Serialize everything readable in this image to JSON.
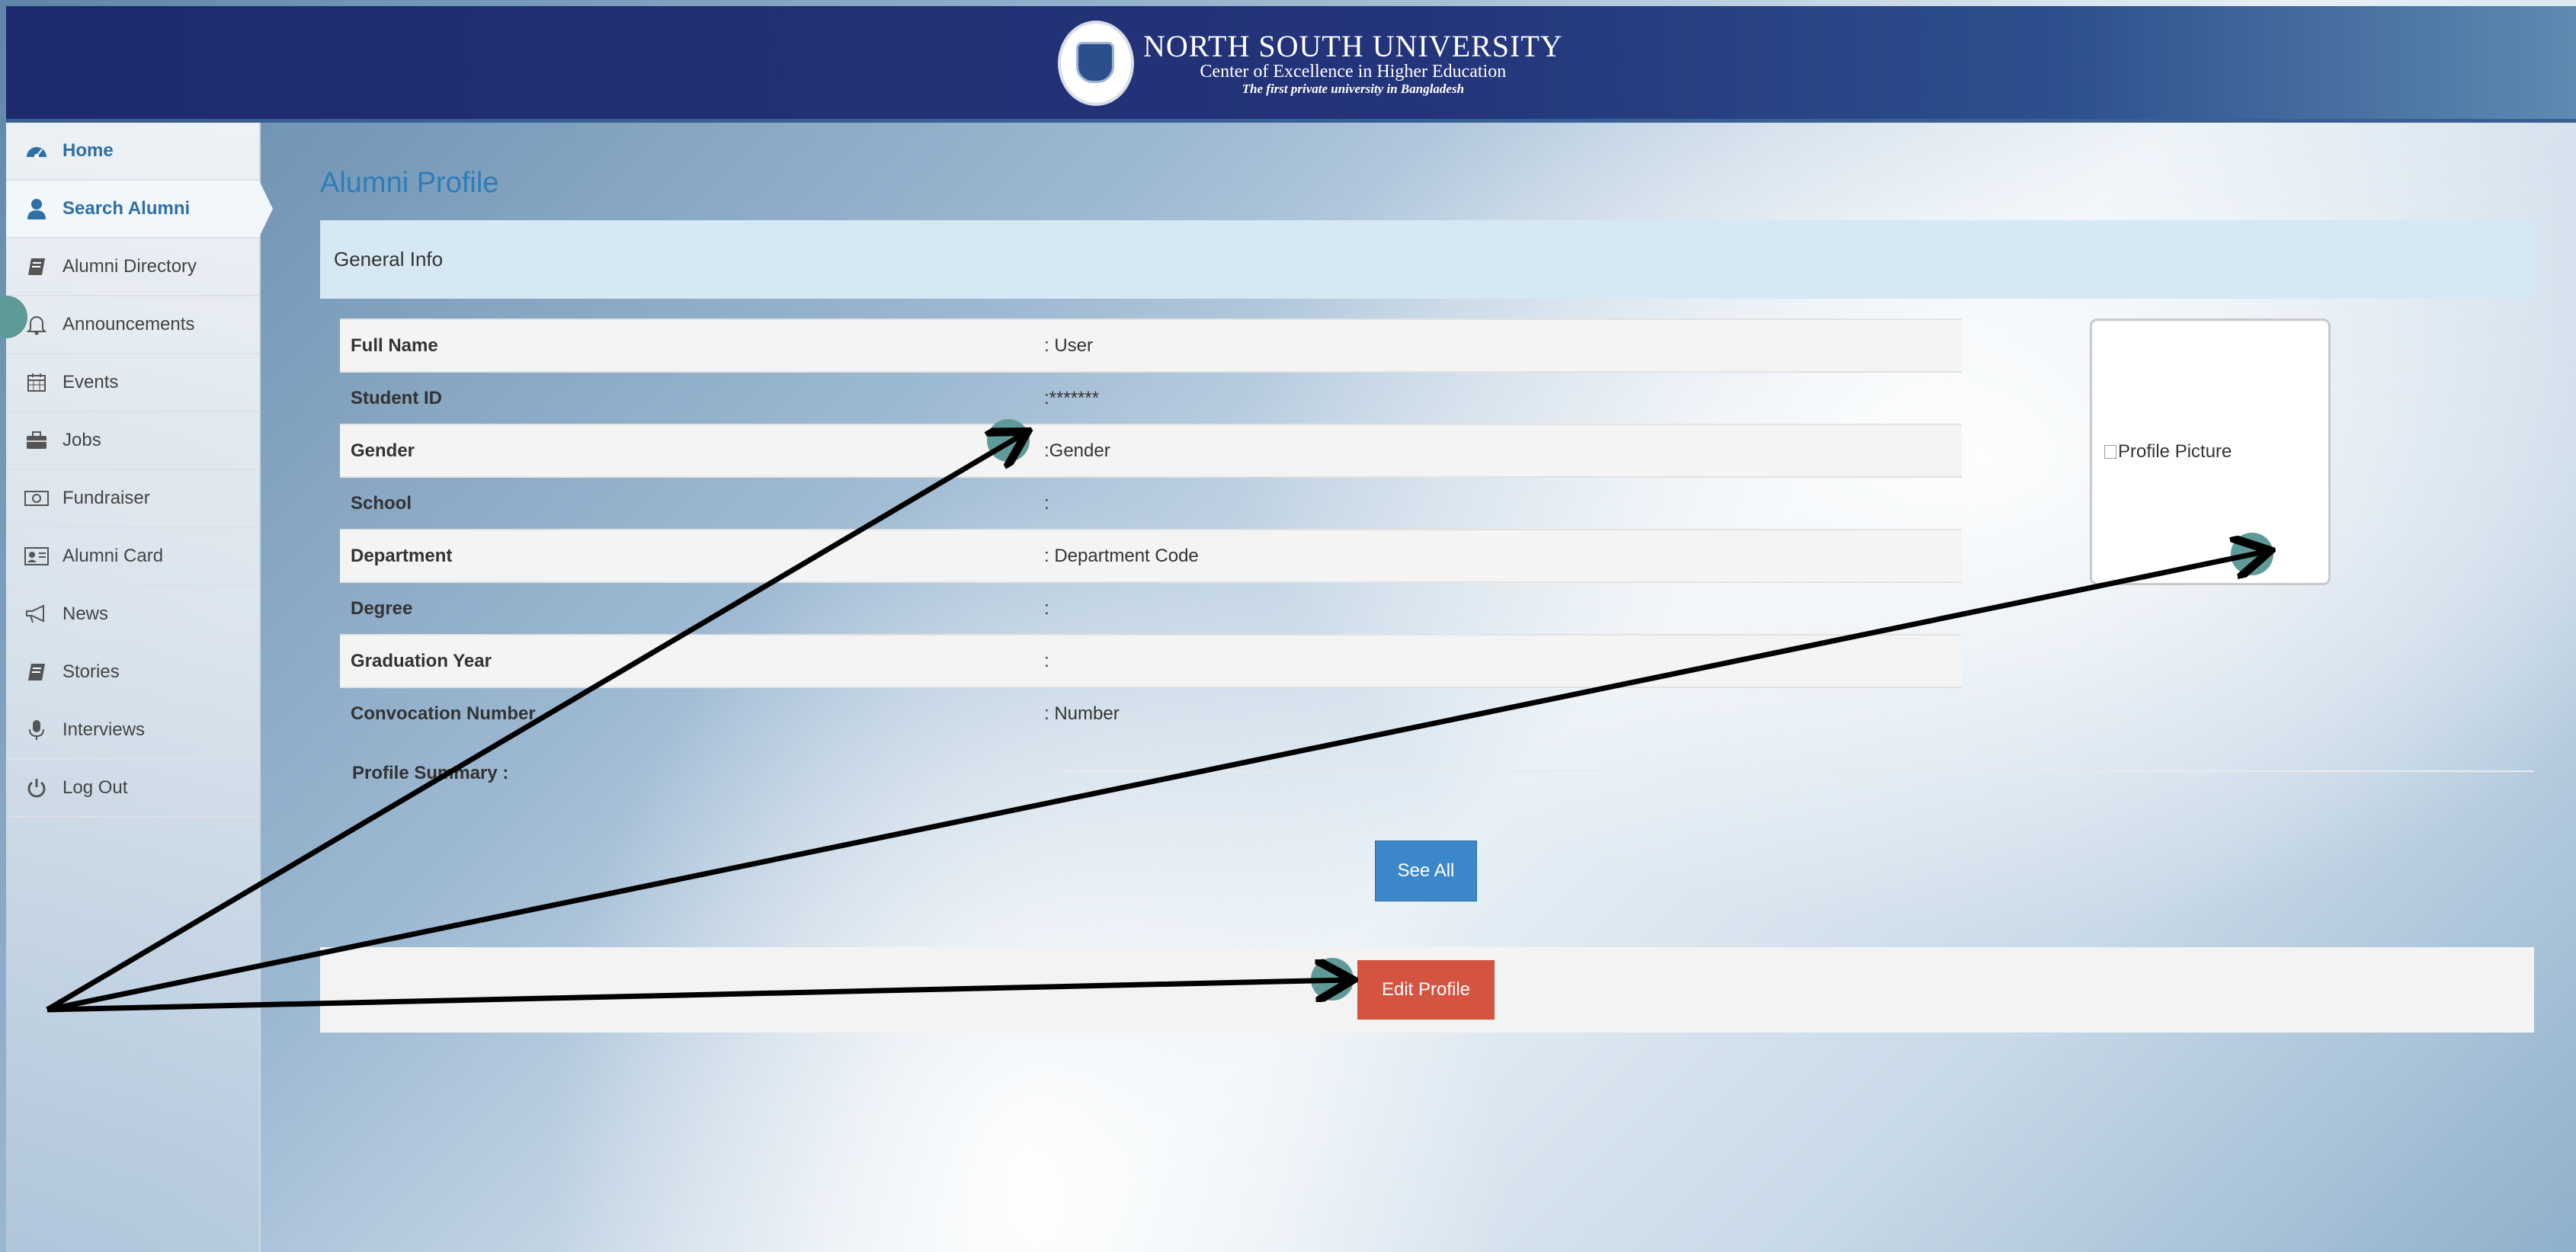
{
  "header": {
    "university_name": "NORTH SOUTH UNIVERSITY",
    "tagline": "Center of Excellence in Higher Education",
    "motto": "The first private university in Bangladesh"
  },
  "sidebar": {
    "items": [
      {
        "label": "Home",
        "icon": "dashboard-icon"
      },
      {
        "label": "Search Alumni",
        "icon": "user-icon"
      },
      {
        "label": "Alumni Directory",
        "icon": "book-icon"
      },
      {
        "label": "Announcements",
        "icon": "bell-icon"
      },
      {
        "label": "Events",
        "icon": "calendar-icon"
      },
      {
        "label": "Jobs",
        "icon": "briefcase-icon"
      },
      {
        "label": "Fundraiser",
        "icon": "money-icon"
      },
      {
        "label": "Alumni Card",
        "icon": "id-card-icon"
      },
      {
        "label": "News",
        "icon": "megaphone-icon"
      },
      {
        "label": "Stories",
        "icon": "book-icon"
      },
      {
        "label": "Interviews",
        "icon": "microphone-icon"
      },
      {
        "label": "Log Out",
        "icon": "power-icon"
      }
    ],
    "active": "Search Alumni"
  },
  "main": {
    "title": "Alumni Profile",
    "section_title": "General Info",
    "rows": [
      {
        "label": "Full Name",
        "value": ": User"
      },
      {
        "label": "Student ID",
        "value": ":*******"
      },
      {
        "label": "Gender",
        "value": ":Gender"
      },
      {
        "label": "School",
        "value": ":"
      },
      {
        "label": "Department",
        "value": ": Department Code"
      },
      {
        "label": "Degree",
        "value": ":"
      },
      {
        "label": "Graduation Year",
        "value": ":"
      },
      {
        "label": "Convocation Number",
        "value": ": Number"
      }
    ],
    "profile_picture_alt": "Profile Picture",
    "summary_label": "Profile Summary :",
    "see_all_label": "See All",
    "edit_label": "Edit Profile"
  },
  "colors": {
    "header_bg": "#24347a",
    "accent_blue": "#3c87c9",
    "edit_red": "#d35440",
    "panel_head": "#d6e8f3",
    "annotation_circle": "#5e9a97"
  }
}
